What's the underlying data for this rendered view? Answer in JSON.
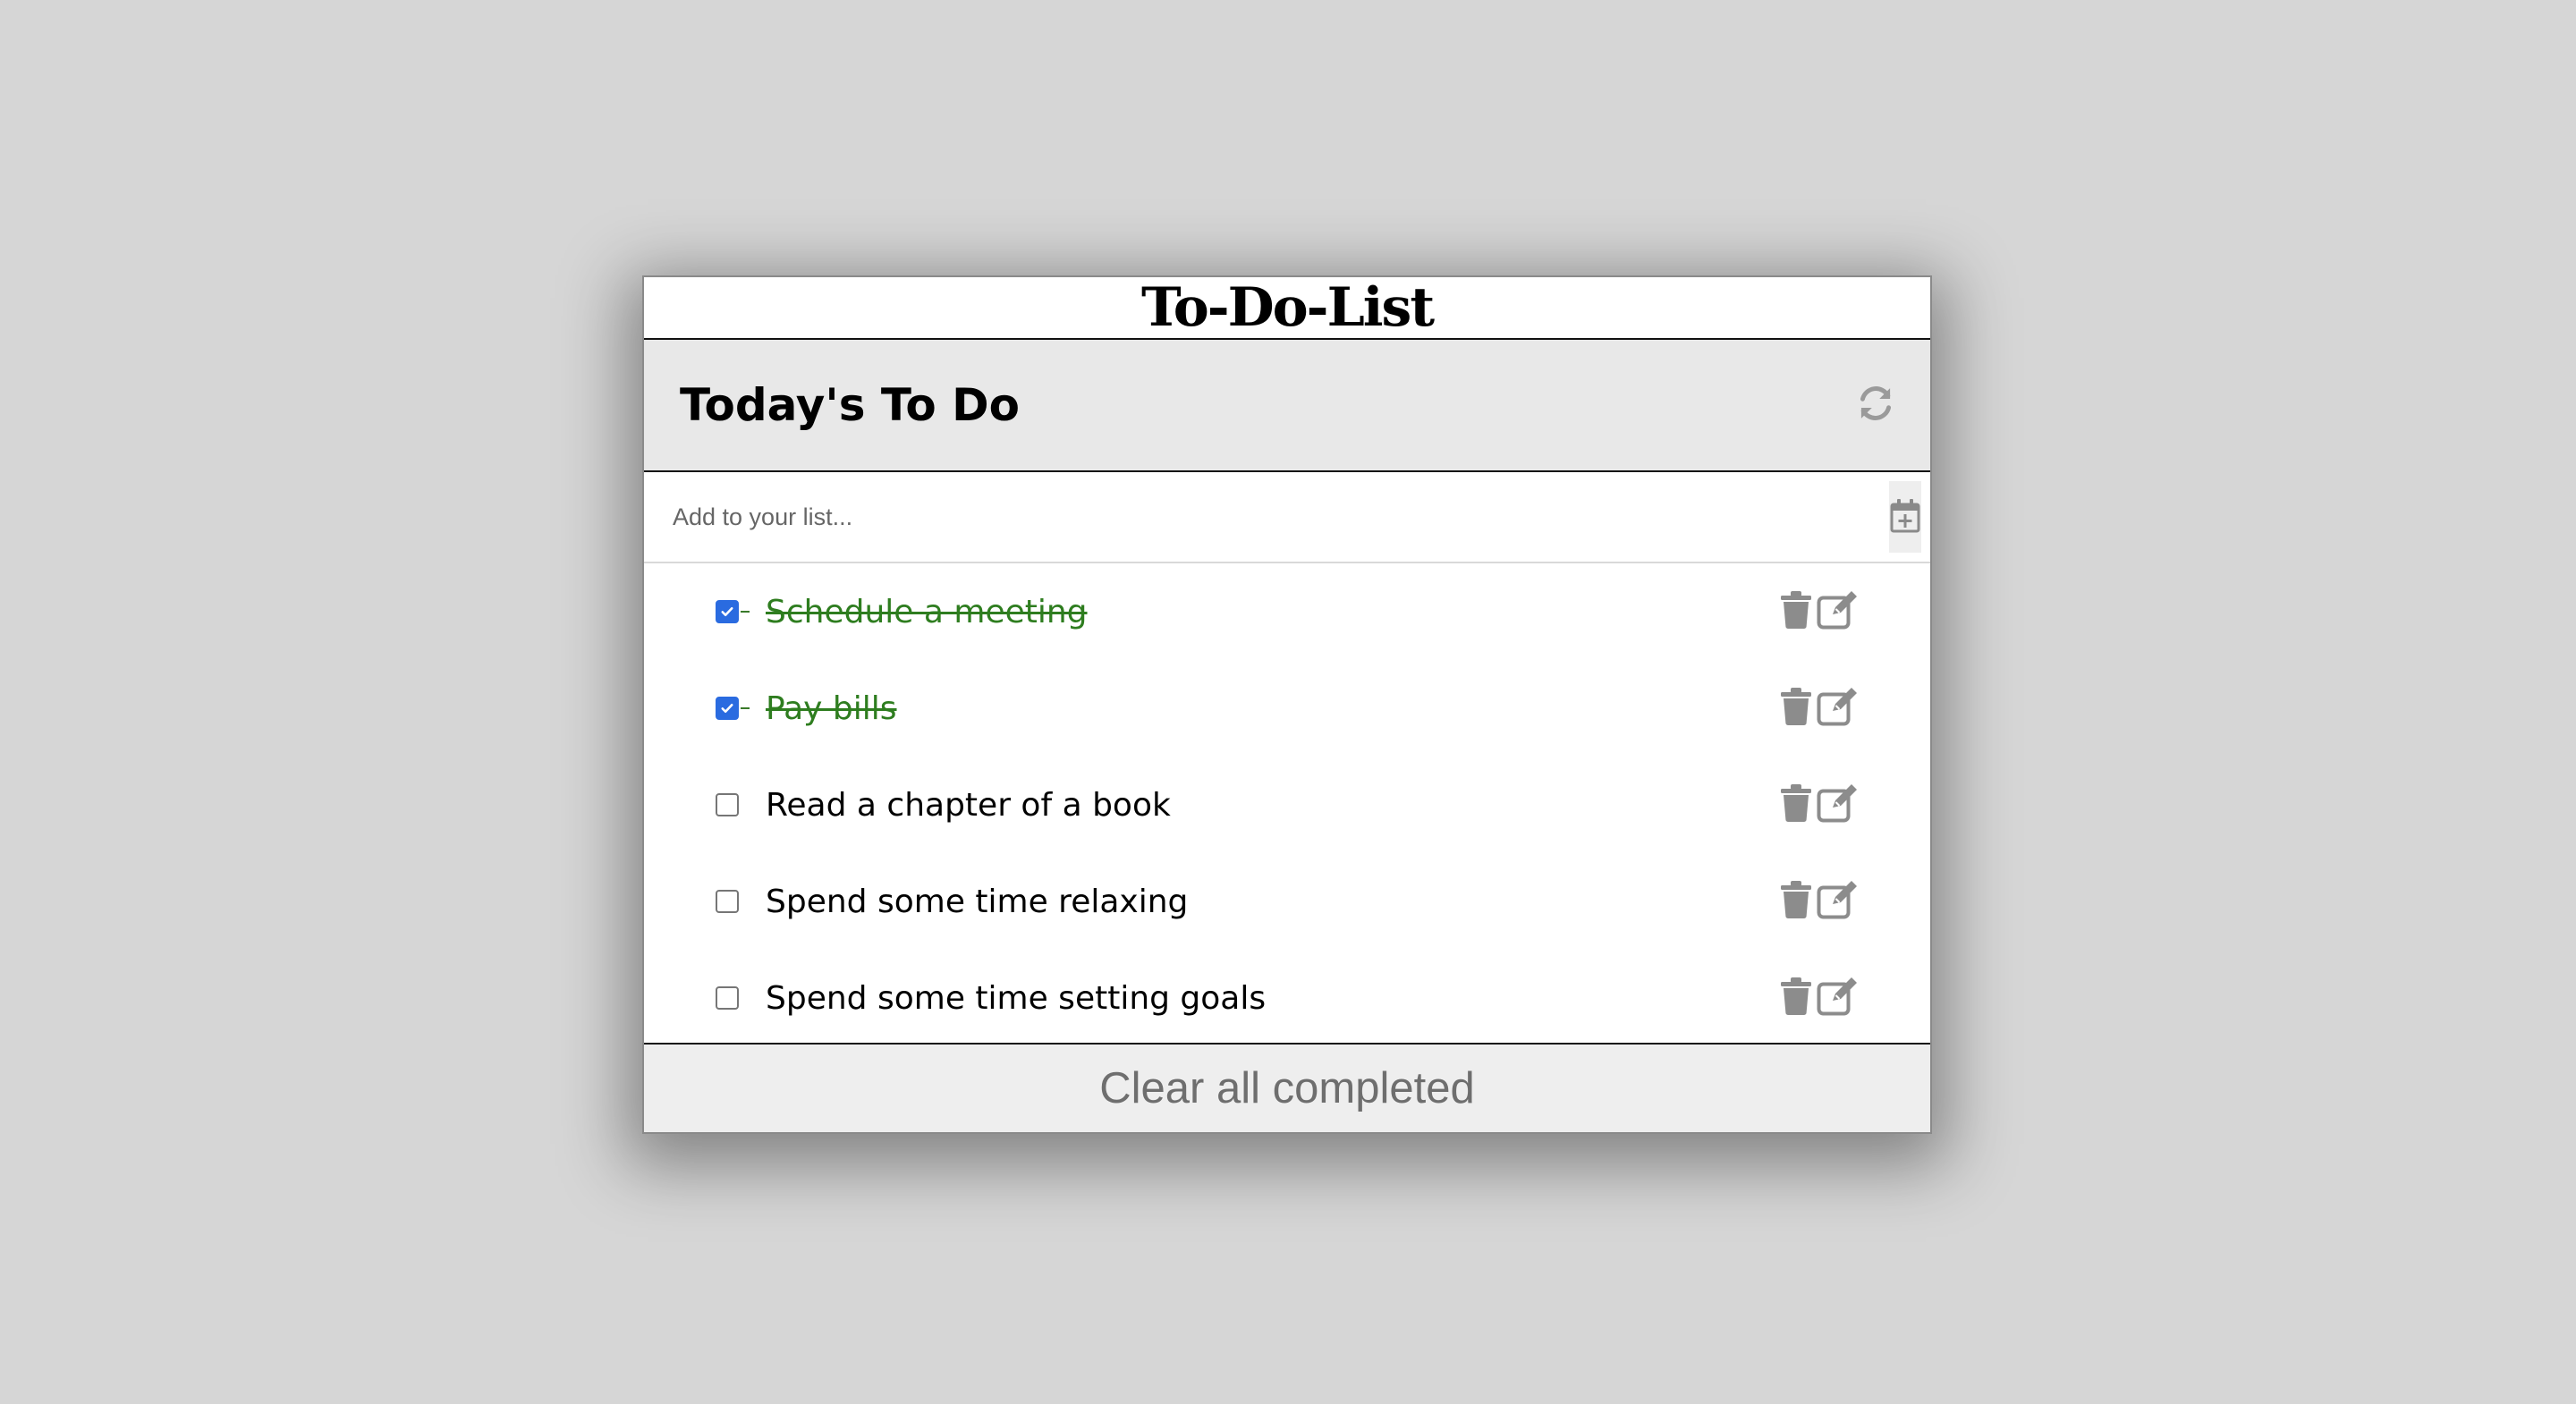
{
  "app": {
    "title": "To-Do-List"
  },
  "header": {
    "list_title": "Today's To Do",
    "refresh_icon": "refresh-icon"
  },
  "add_item": {
    "placeholder": "Add to your list...",
    "value": "",
    "add_icon": "calendar-plus-icon"
  },
  "items": [
    {
      "text": "Schedule a meeting",
      "completed": true
    },
    {
      "text": "Pay bills",
      "completed": true
    },
    {
      "text": "Read a chapter of a book",
      "completed": false
    },
    {
      "text": "Spend some time relaxing",
      "completed": false
    },
    {
      "text": "Spend some time setting goals",
      "completed": false
    }
  ],
  "item_actions": {
    "delete_icon": "trash-icon",
    "edit_icon": "edit-icon"
  },
  "footer": {
    "clear_label": "Clear all completed"
  },
  "colors": {
    "background": "#d6d6d6",
    "completed_text": "#2e7d1f",
    "icon_gray": "#8c8c8c",
    "checkbox_accent": "#2a6be0"
  }
}
